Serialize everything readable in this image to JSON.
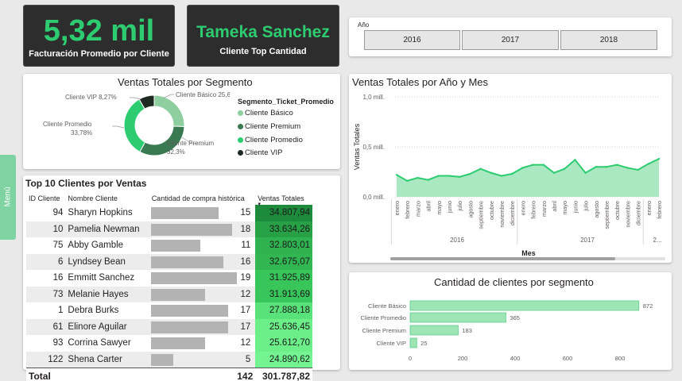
{
  "kpi1": {
    "value": "5,32 mil",
    "label": "Facturación Promedio por Cliente"
  },
  "kpi2": {
    "value": "Tameka Sanchez",
    "label": "Cliente Top Cantidad"
  },
  "year_filter": {
    "label": "Año",
    "options": [
      "2016",
      "2017",
      "2018"
    ]
  },
  "menu": {
    "label": "Menú"
  },
  "donut": {
    "title": "Ventas Totales por Segmento",
    "legend_title": "Segmento_Ticket_Promedio",
    "segments": [
      {
        "name": "Cliente Básico",
        "pct": 25.65,
        "label": "Cliente Básico 25,65%",
        "color": "#8fcf9f"
      },
      {
        "name": "Cliente Premium",
        "pct": 32.3,
        "label_a": "Cliente Premium",
        "label_b": "32,3%",
        "color": "#3a7a52"
      },
      {
        "name": "Cliente Promedio",
        "pct": 33.78,
        "label_a": "Cliente Promedio",
        "label_b": "33,78%",
        "color": "#2ecc71"
      },
      {
        "name": "Cliente VIP",
        "pct": 8.27,
        "label": "Cliente VIP 8,27%",
        "color": "#1f2a24"
      }
    ]
  },
  "top10": {
    "title": "Top 10 Clientes por Ventas",
    "headers": [
      "ID Cliente",
      "Nombre Cliente",
      "Cantidad de compra histórica",
      "Ventas Totales"
    ],
    "rows": [
      {
        "id": "94",
        "name": "Sharyn Hopkins",
        "qty": "15",
        "qty_n": 15,
        "sales": "34.807,94",
        "sales_color": "#1e8a3c"
      },
      {
        "id": "10",
        "name": "Pamelia Newman",
        "qty": "18",
        "qty_n": 18,
        "sales": "33.634,26",
        "sales_color": "#27a046"
      },
      {
        "id": "75",
        "name": "Abby Gamble",
        "qty": "11",
        "qty_n": 11,
        "sales": "32.803,01",
        "sales_color": "#2fb24f"
      },
      {
        "id": "6",
        "name": "Lyndsey Bean",
        "qty": "16",
        "qty_n": 16,
        "sales": "32.675,07",
        "sales_color": "#31b652"
      },
      {
        "id": "16",
        "name": "Emmitt Sanchez",
        "qty": "19",
        "qty_n": 19,
        "sales": "31.925,89",
        "sales_color": "#38c55a"
      },
      {
        "id": "73",
        "name": "Melanie Hayes",
        "qty": "12",
        "qty_n": 12,
        "sales": "31.913,69",
        "sales_color": "#38c55a"
      },
      {
        "id": "1",
        "name": "Debra Burks",
        "qty": "17",
        "qty_n": 17,
        "sales": "27.888,18",
        "sales_color": "#5ae27a"
      },
      {
        "id": "61",
        "name": "Elinore Aguilar",
        "qty": "17",
        "qty_n": 17,
        "sales": "25.636,45",
        "sales_color": "#6cef89"
      },
      {
        "id": "93",
        "name": "Corrina Sawyer",
        "qty": "12",
        "qty_n": 12,
        "sales": "25.612,70",
        "sales_color": "#6cef89"
      },
      {
        "id": "122",
        "name": "Shena Carter",
        "qty": "5",
        "qty_n": 5,
        "sales": "24.890,62",
        "sales_color": "#74f491"
      }
    ],
    "total": {
      "label": "Total",
      "qty": "142",
      "sales": "301.787,82"
    }
  },
  "line_chart": {
    "title": "Ventas Totales por Año y Mes",
    "ylabel": "Ventas Totales",
    "xlabel": "Mes",
    "yticks": [
      "1,0 mill.",
      "0,5 mill.",
      "0,0 mill."
    ],
    "months": [
      "enero",
      "febrero",
      "marzo",
      "abril",
      "mayo",
      "junio",
      "julio",
      "agosto",
      "septiembre",
      "octubre",
      "noviembre",
      "diciembre",
      "enero",
      "febrero",
      "marzo",
      "abril",
      "mayo",
      "junio",
      "julio",
      "agosto",
      "septiembre",
      "octubre",
      "noviembre",
      "diciembre",
      "enero",
      "febrero"
    ],
    "years": [
      "2016",
      "2017",
      "2..."
    ]
  },
  "bar_chart": {
    "title": "Cantidad de clientes por segmento",
    "xticks": [
      "0",
      "200",
      "400",
      "600",
      "800"
    ]
  },
  "chart_data": [
    {
      "type": "pie",
      "title": "Ventas Totales por Segmento",
      "categories": [
        "Cliente Básico",
        "Cliente Premium",
        "Cliente Promedio",
        "Cliente VIP"
      ],
      "values": [
        25.65,
        32.3,
        33.78,
        8.27
      ]
    },
    {
      "type": "area",
      "title": "Ventas Totales por Año y Mes",
      "ylabel": "Ventas Totales",
      "xlabel": "Mes",
      "ylim": [
        0,
        1000000
      ],
      "x": [
        "2016-01",
        "2016-02",
        "2016-03",
        "2016-04",
        "2016-05",
        "2016-06",
        "2016-07",
        "2016-08",
        "2016-09",
        "2016-10",
        "2016-11",
        "2016-12",
        "2017-01",
        "2017-02",
        "2017-03",
        "2017-04",
        "2017-05",
        "2017-06",
        "2017-07",
        "2017-08",
        "2017-09",
        "2017-10",
        "2017-11",
        "2017-12",
        "2018-01",
        "2018-02"
      ],
      "values": [
        220000,
        160000,
        190000,
        170000,
        210000,
        210000,
        200000,
        230000,
        280000,
        240000,
        210000,
        230000,
        290000,
        320000,
        320000,
        240000,
        280000,
        370000,
        240000,
        300000,
        300000,
        320000,
        290000,
        270000,
        330000,
        380000
      ]
    },
    {
      "type": "bar",
      "title": "Cantidad de clientes por segmento",
      "categories": [
        "Cliente Básico",
        "Cliente Promedio",
        "Cliente Premium",
        "Cliente VIP"
      ],
      "values": [
        872,
        365,
        183,
        25
      ],
      "xlim": [
        0,
        900
      ]
    }
  ]
}
